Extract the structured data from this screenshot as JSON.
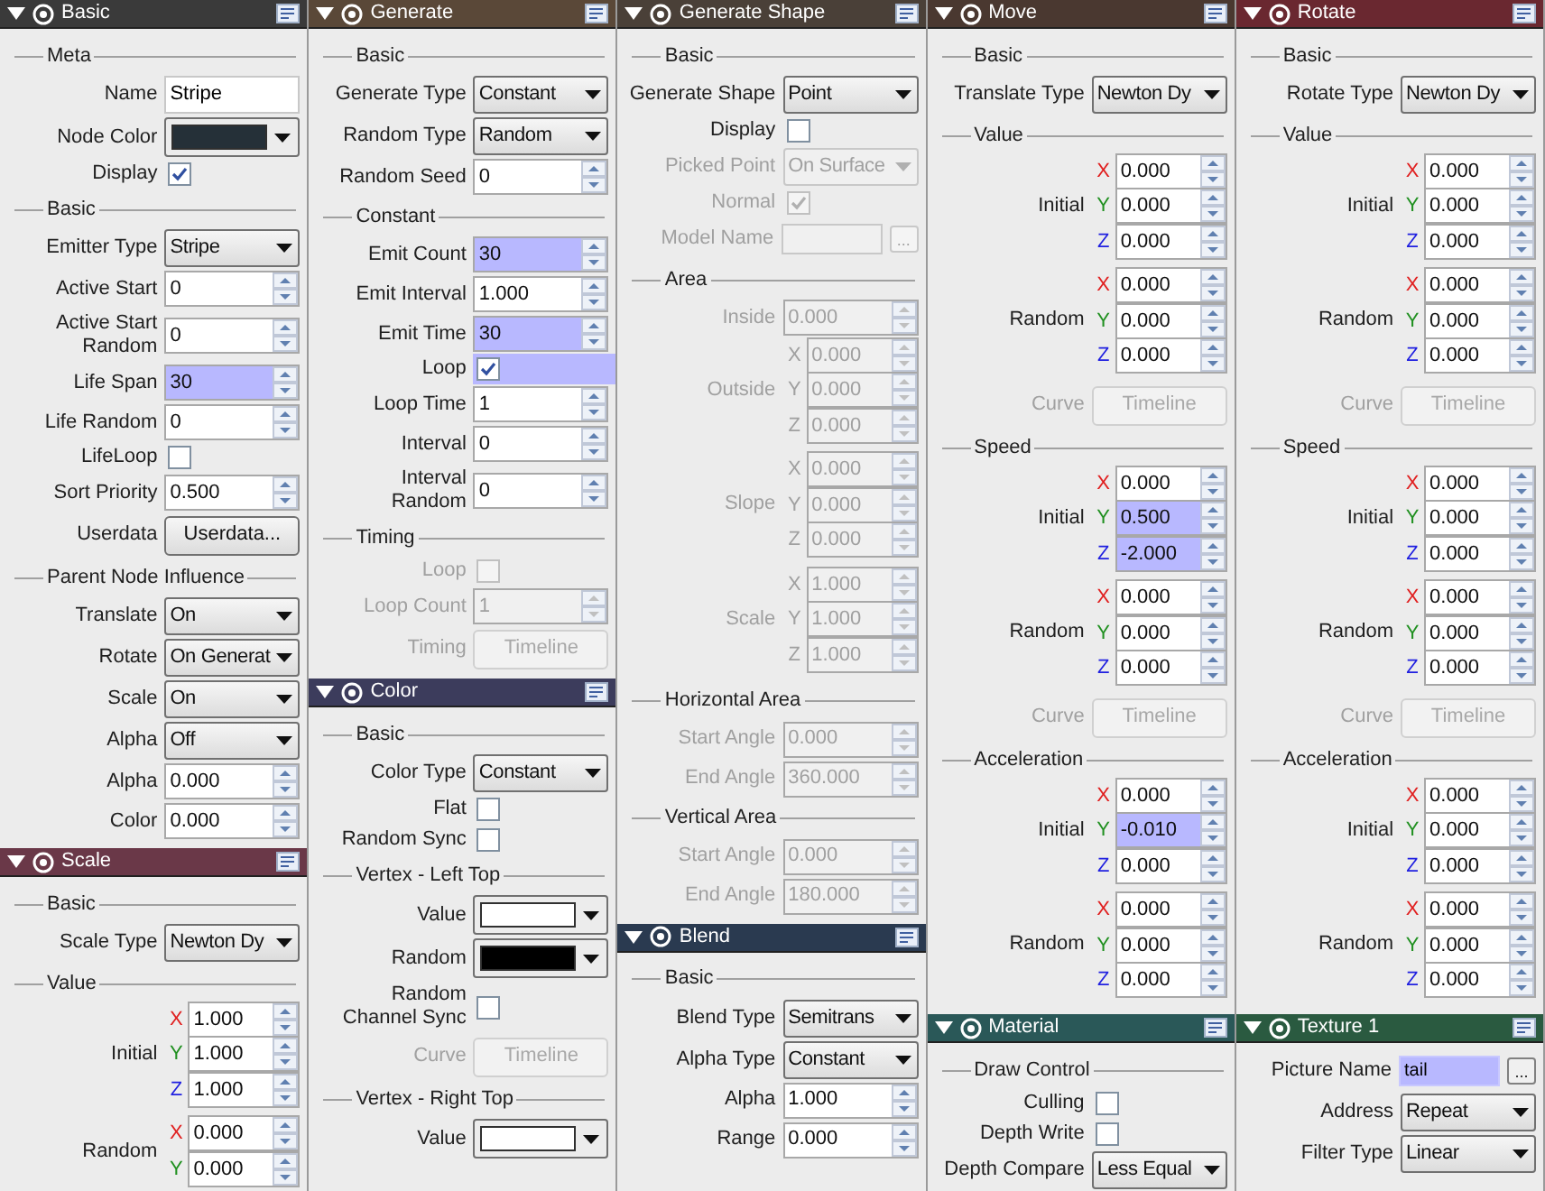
{
  "columns": [
    {
      "panels": [
        {
          "title": "Basic",
          "color": "#3a3a3a",
          "rows": [
            {
              "kind": "group",
              "label": "Meta"
            },
            {
              "kind": "text",
              "label": "Name",
              "value": "Stripe"
            },
            {
              "kind": "color",
              "label": "Node Color",
              "color": "#253038"
            },
            {
              "kind": "check",
              "label": "Display",
              "checked": true
            },
            {
              "kind": "group",
              "label": "Basic"
            },
            {
              "kind": "select",
              "label": "Emitter Type",
              "value": "Stripe"
            },
            {
              "kind": "spin",
              "label": "Active Start",
              "value": "0"
            },
            {
              "kind": "spin",
              "label": "Active Start\nRandom",
              "value": "0"
            },
            {
              "kind": "spin",
              "label": "Life Span",
              "value": "30",
              "highlighted": true
            },
            {
              "kind": "spin",
              "label": "Life Random",
              "value": "0"
            },
            {
              "kind": "check",
              "label": "LifeLoop",
              "checked": false
            },
            {
              "kind": "spin",
              "label": "Sort Priority",
              "value": "0.500"
            },
            {
              "kind": "button",
              "label": "Userdata",
              "button": "Userdata..."
            },
            {
              "kind": "group",
              "label": "Parent Node Influence"
            },
            {
              "kind": "select",
              "label": "Translate",
              "value": "On"
            },
            {
              "kind": "select",
              "label": "Rotate",
              "value": "On Generat"
            },
            {
              "kind": "select",
              "label": "Scale",
              "value": "On"
            },
            {
              "kind": "select",
              "label": "Alpha",
              "value": "Off"
            },
            {
              "kind": "spin",
              "label": "Alpha",
              "value": "0.000"
            },
            {
              "kind": "spin",
              "label": "Color",
              "value": "0.000"
            }
          ]
        },
        {
          "title": "Scale",
          "color": "#6a3848",
          "rows": [
            {
              "kind": "group",
              "label": "Basic"
            },
            {
              "kind": "select",
              "label": "Scale Type",
              "value": "Newton Dy"
            },
            {
              "kind": "group",
              "label": "Value"
            },
            {
              "kind": "xyz",
              "label": "Initial",
              "values": [
                {
                  "axis": "X",
                  "value": "1.000"
                },
                {
                  "axis": "Y",
                  "value": "1.000"
                },
                {
                  "axis": "Z",
                  "value": "1.000"
                }
              ]
            },
            {
              "kind": "xyz",
              "label": "Random",
              "values": [
                {
                  "axis": "X",
                  "value": "0.000"
                },
                {
                  "axis": "Y",
                  "value": "0.000"
                }
              ]
            }
          ]
        }
      ]
    },
    {
      "panels": [
        {
          "title": "Generate",
          "color": "#5a4838",
          "rows": [
            {
              "kind": "group",
              "label": "Basic"
            },
            {
              "kind": "select",
              "label": "Generate Type",
              "value": "Constant"
            },
            {
              "kind": "select",
              "label": "Random Type",
              "value": "Random"
            },
            {
              "kind": "spin",
              "label": "Random Seed",
              "value": "0"
            },
            {
              "kind": "group",
              "label": "Constant"
            },
            {
              "kind": "spin",
              "label": "Emit Count",
              "value": "30",
              "highlighted": true
            },
            {
              "kind": "spin",
              "label": "Emit Interval",
              "value": "1.000"
            },
            {
              "kind": "spin",
              "label": "Emit Time",
              "value": "30",
              "highlighted": true
            },
            {
              "kind": "check",
              "label": "Loop",
              "checked": true,
              "highlighted": true
            },
            {
              "kind": "spin",
              "label": "Loop Time",
              "value": "1"
            },
            {
              "kind": "spin",
              "label": "Interval",
              "value": "0"
            },
            {
              "kind": "spin",
              "label": "Interval\nRandom",
              "value": "0"
            },
            {
              "kind": "group",
              "label": "Timing"
            },
            {
              "kind": "check",
              "label": "Loop",
              "checked": false,
              "disabled": true
            },
            {
              "kind": "spin",
              "label": "Loop Count",
              "value": "1",
              "disabled": true
            },
            {
              "kind": "button",
              "label": "Timing",
              "button": "Timeline",
              "disabled": true
            }
          ]
        },
        {
          "title": "Color",
          "color": "#3c3c5c",
          "rows": [
            {
              "kind": "group",
              "label": "Basic"
            },
            {
              "kind": "select",
              "label": "Color Type",
              "value": "Constant"
            },
            {
              "kind": "check",
              "label": "Flat",
              "checked": false
            },
            {
              "kind": "check",
              "label": "Random Sync",
              "checked": false
            },
            {
              "kind": "group",
              "label": "Vertex - Left Top"
            },
            {
              "kind": "color",
              "label": "Value",
              "color": "#ffffff"
            },
            {
              "kind": "color",
              "label": "Random",
              "color": "#000000"
            },
            {
              "kind": "check",
              "label": "Random\nChannel Sync",
              "checked": false
            },
            {
              "kind": "button",
              "label": "Curve",
              "button": "Timeline",
              "disabled": true
            },
            {
              "kind": "group",
              "label": "Vertex - Right Top"
            },
            {
              "kind": "color",
              "label": "Value",
              "color": "#ffffff"
            }
          ]
        }
      ]
    },
    {
      "panels": [
        {
          "title": "Generate Shape",
          "color": "#4a4038",
          "rows": [
            {
              "kind": "group",
              "label": "Basic"
            },
            {
              "kind": "select",
              "label": "Generate Shape",
              "value": "Point"
            },
            {
              "kind": "check",
              "label": "Display",
              "checked": false
            },
            {
              "kind": "select",
              "label": "Picked Point",
              "value": "On Surface",
              "disabled": true
            },
            {
              "kind": "check",
              "label": "Normal",
              "checked": true,
              "disabled": true
            },
            {
              "kind": "model",
              "label": "Model Name",
              "button": "...",
              "disabled": true
            },
            {
              "kind": "group",
              "label": "Area"
            },
            {
              "kind": "spin",
              "label": "Inside",
              "value": "0.000",
              "disabled": true
            },
            {
              "kind": "xyz",
              "label": "Outside",
              "disabled": true,
              "values": [
                {
                  "axis": "X",
                  "value": "0.000"
                },
                {
                  "axis": "Y",
                  "value": "0.000"
                },
                {
                  "axis": "Z",
                  "value": "0.000"
                }
              ]
            },
            {
              "kind": "xyz",
              "label": "Slope",
              "disabled": true,
              "values": [
                {
                  "axis": "X",
                  "value": "0.000"
                },
                {
                  "axis": "Y",
                  "value": "0.000"
                },
                {
                  "axis": "Z",
                  "value": "0.000"
                }
              ]
            },
            {
              "kind": "xyz",
              "label": "Scale",
              "disabled": true,
              "values": [
                {
                  "axis": "X",
                  "value": "1.000"
                },
                {
                  "axis": "Y",
                  "value": "1.000"
                },
                {
                  "axis": "Z",
                  "value": "1.000"
                }
              ]
            },
            {
              "kind": "group",
              "label": "Horizontal Area"
            },
            {
              "kind": "spin",
              "label": "Start Angle",
              "value": "0.000",
              "disabled": true
            },
            {
              "kind": "spin",
              "label": "End Angle",
              "value": "360.000",
              "disabled": true
            },
            {
              "kind": "group",
              "label": "Vertical Area"
            },
            {
              "kind": "spin",
              "label": "Start Angle",
              "value": "0.000",
              "disabled": true
            },
            {
              "kind": "spin",
              "label": "End Angle",
              "value": "180.000",
              "disabled": true
            }
          ]
        },
        {
          "title": "Blend",
          "color": "#2a3a50",
          "rows": [
            {
              "kind": "group",
              "label": "Basic"
            },
            {
              "kind": "select",
              "label": "Blend Type",
              "value": "Semitrans"
            },
            {
              "kind": "select",
              "label": "Alpha Type",
              "value": "Constant"
            },
            {
              "kind": "spin",
              "label": "Alpha",
              "value": "1.000"
            },
            {
              "kind": "spin",
              "label": "Range",
              "value": "0.000"
            }
          ]
        }
      ]
    },
    {
      "panels": [
        {
          "title": "Move",
          "color": "#4a3830",
          "rows": [
            {
              "kind": "group",
              "label": "Basic"
            },
            {
              "kind": "select",
              "label": "Translate Type",
              "value": "Newton Dy"
            },
            {
              "kind": "group",
              "label": "Value"
            },
            {
              "kind": "xyz",
              "label": "Initial",
              "values": [
                {
                  "axis": "X",
                  "value": "0.000"
                },
                {
                  "axis": "Y",
                  "value": "0.000"
                },
                {
                  "axis": "Z",
                  "value": "0.000"
                }
              ]
            },
            {
              "kind": "xyz",
              "label": "Random",
              "values": [
                {
                  "axis": "X",
                  "value": "0.000"
                },
                {
                  "axis": "Y",
                  "value": "0.000"
                },
                {
                  "axis": "Z",
                  "value": "0.000"
                }
              ]
            },
            {
              "kind": "button",
              "label": "Curve",
              "button": "Timeline",
              "disabled": true
            },
            {
              "kind": "group",
              "label": "Speed"
            },
            {
              "kind": "xyz",
              "label": "Initial",
              "values": [
                {
                  "axis": "X",
                  "value": "0.000"
                },
                {
                  "axis": "Y",
                  "value": "0.500",
                  "highlighted": true
                },
                {
                  "axis": "Z",
                  "value": "-2.000",
                  "highlighted": true
                }
              ]
            },
            {
              "kind": "xyz",
              "label": "Random",
              "values": [
                {
                  "axis": "X",
                  "value": "0.000"
                },
                {
                  "axis": "Y",
                  "value": "0.000"
                },
                {
                  "axis": "Z",
                  "value": "0.000"
                }
              ]
            },
            {
              "kind": "button",
              "label": "Curve",
              "button": "Timeline",
              "disabled": true
            },
            {
              "kind": "group",
              "label": "Acceleration"
            },
            {
              "kind": "xyz",
              "label": "Initial",
              "values": [
                {
                  "axis": "X",
                  "value": "0.000"
                },
                {
                  "axis": "Y",
                  "value": "-0.010",
                  "highlighted": true
                },
                {
                  "axis": "Z",
                  "value": "0.000"
                }
              ]
            },
            {
              "kind": "xyz",
              "label": "Random",
              "values": [
                {
                  "axis": "X",
                  "value": "0.000"
                },
                {
                  "axis": "Y",
                  "value": "0.000"
                },
                {
                  "axis": "Z",
                  "value": "0.000"
                }
              ]
            }
          ]
        },
        {
          "title": "Material",
          "color": "#2a5858",
          "rows": [
            {
              "kind": "group",
              "label": "Draw Control"
            },
            {
              "kind": "check",
              "label": "Culling",
              "checked": false
            },
            {
              "kind": "check",
              "label": "Depth Write",
              "checked": false
            },
            {
              "kind": "select",
              "label": "Depth Compare",
              "value": "Less Equal"
            }
          ]
        }
      ]
    },
    {
      "panels": [
        {
          "title": "Rotate",
          "color": "#6a2830",
          "rows": [
            {
              "kind": "group",
              "label": "Basic"
            },
            {
              "kind": "select",
              "label": "Rotate Type",
              "value": "Newton Dy"
            },
            {
              "kind": "group",
              "label": "Value"
            },
            {
              "kind": "xyz",
              "label": "Initial",
              "values": [
                {
                  "axis": "X",
                  "value": "0.000"
                },
                {
                  "axis": "Y",
                  "value": "0.000"
                },
                {
                  "axis": "Z",
                  "value": "0.000"
                }
              ]
            },
            {
              "kind": "xyz",
              "label": "Random",
              "values": [
                {
                  "axis": "X",
                  "value": "0.000"
                },
                {
                  "axis": "Y",
                  "value": "0.000"
                },
                {
                  "axis": "Z",
                  "value": "0.000"
                }
              ]
            },
            {
              "kind": "button",
              "label": "Curve",
              "button": "Timeline",
              "disabled": true
            },
            {
              "kind": "group",
              "label": "Speed"
            },
            {
              "kind": "xyz",
              "label": "Initial",
              "values": [
                {
                  "axis": "X",
                  "value": "0.000"
                },
                {
                  "axis": "Y",
                  "value": "0.000"
                },
                {
                  "axis": "Z",
                  "value": "0.000"
                }
              ]
            },
            {
              "kind": "xyz",
              "label": "Random",
              "values": [
                {
                  "axis": "X",
                  "value": "0.000"
                },
                {
                  "axis": "Y",
                  "value": "0.000"
                },
                {
                  "axis": "Z",
                  "value": "0.000"
                }
              ]
            },
            {
              "kind": "button",
              "label": "Curve",
              "button": "Timeline",
              "disabled": true
            },
            {
              "kind": "group",
              "label": "Acceleration"
            },
            {
              "kind": "xyz",
              "label": "Initial",
              "values": [
                {
                  "axis": "X",
                  "value": "0.000"
                },
                {
                  "axis": "Y",
                  "value": "0.000"
                },
                {
                  "axis": "Z",
                  "value": "0.000"
                }
              ]
            },
            {
              "kind": "xyz",
              "label": "Random",
              "values": [
                {
                  "axis": "X",
                  "value": "0.000"
                },
                {
                  "axis": "Y",
                  "value": "0.000"
                },
                {
                  "axis": "Z",
                  "value": "0.000"
                }
              ]
            }
          ]
        },
        {
          "title": "Texture 1",
          "color": "#2a5a40",
          "rows": [
            {
              "kind": "picture",
              "label": "Picture Name",
              "value": "tail",
              "highlighted": true,
              "button": "..."
            },
            {
              "kind": "select",
              "label": "Address",
              "value": "Repeat"
            },
            {
              "kind": "select",
              "label": "Filter Type",
              "value": "Linear"
            }
          ]
        }
      ]
    }
  ]
}
